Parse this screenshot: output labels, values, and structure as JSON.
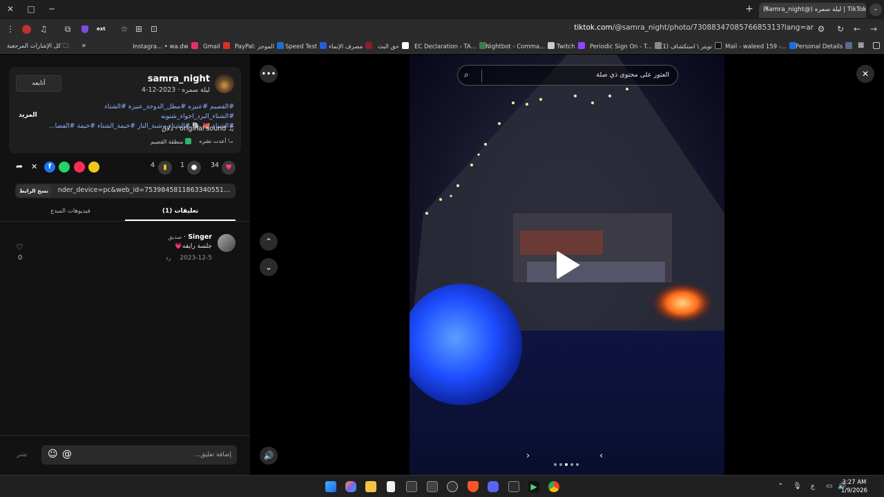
{
  "browser": {
    "tab_title": "(samra_night@) ليلة سمره | TikTok",
    "url_domain": "tiktok.com",
    "url_path": "/@samra_night/photo/7308834708576685313?lang=ar",
    "window_min": "─",
    "window_max": "□",
    "window_close": "✕",
    "new_tab": "+",
    "bookmarks": [
      {
        "label": "Personal Details",
        "color": "#5a6b8c"
      },
      {
        "label": "Mail - waleed 159 -...",
        "color": "#1e6fd9"
      },
      {
        "label": "(1) تويتر \\ استكشاف",
        "color": "#111111"
      },
      {
        "label": "Periodic Sign On - T...",
        "color": "#8a8a8a"
      },
      {
        "label": "Twitch",
        "color": "#9146ff"
      },
      {
        "label": "Nightbot - Comma...",
        "color": "#cccccc"
      },
      {
        "label": "EC Declaration - TA...",
        "color": "#3b7a57"
      },
      {
        "label": "حق البث",
        "color": "#ffffff"
      },
      {
        "label": "مصرف الإنماء",
        "color": "#8b1d2c"
      },
      {
        "label": "Speed Test",
        "color": "#2a5bd7"
      },
      {
        "label": "PayPal: الموجز",
        "color": "#1f6fd0"
      },
      {
        "label": "Gmail",
        "color": "#d93025"
      },
      {
        "label": "Instagra... • wa.dw",
        "color": "#e1306c"
      }
    ],
    "bookmarks_overflow": "»",
    "all_bookmarks": "كل الإشارات المرجعية"
  },
  "post": {
    "username": "samra_night",
    "display_name": "ليلة سمره",
    "date": "2023-12-4",
    "follow_label": "أتابعه",
    "hashtags_line1": "#القصيم #عنيزه #مطل_الدوحة_عنيزة #الشتاء #الشتاء_البرد_اجواء_شتويه",
    "hashtags_line2": "#الشتاء 🐙 🐘 #الشتاء_وشبة_النار #خيمة_الشتاء #خيمة #الفضا...",
    "more_label": "المزيد",
    "sound_label": "original sound",
    "sound_author": "دلال",
    "reposted_label": "أعدت نشره",
    "location_label": "منطقة القصيم",
    "likes": "34",
    "comments": "1",
    "saves": "4",
    "share_link": "...p=1&sender_device=pc&web_id=7539845811863340551",
    "copy_link_label": "نسخ الرابط"
  },
  "tabs": {
    "comments_tab": "تعليقات (1)",
    "creator_videos_tab": "فيديوهات المبدع"
  },
  "comment": {
    "user": "Singer",
    "badge": "صديق",
    "text": "جلسة رايقه💗",
    "date": "2023-12-5",
    "reply_label": "رد",
    "like_count": "0"
  },
  "composer": {
    "placeholder": "إضافة تعليق...",
    "post_label": "نشر"
  },
  "media": {
    "search_placeholder": "العثور على محتوى ذي صلة",
    "slide_count": 5,
    "active_slide": 3
  },
  "taskbar": {
    "time": "3:27 AM",
    "date": "1/9/2026",
    "lang": "ع"
  }
}
